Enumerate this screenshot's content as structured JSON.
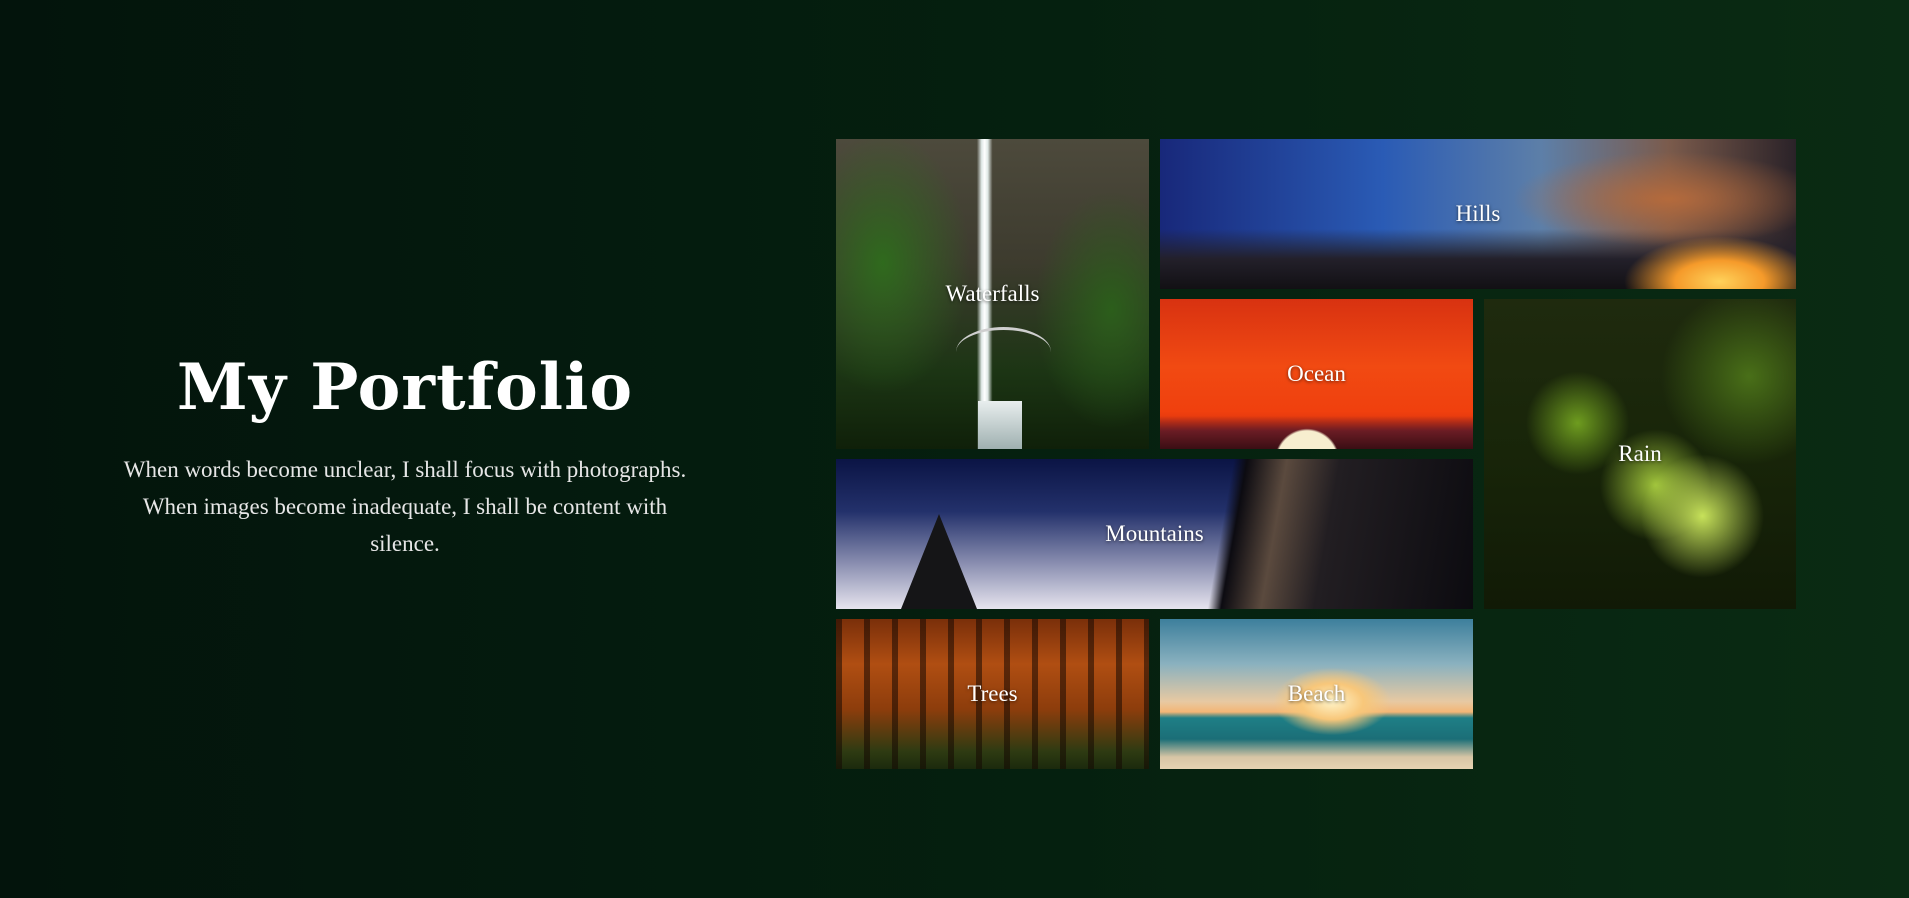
{
  "intro": {
    "title": "My Portfolio",
    "description": "When words become unclear, I shall focus with photographs. When images become inadequate, I shall be content with silence."
  },
  "gallery": {
    "tiles": [
      {
        "label": "Waterfalls"
      },
      {
        "label": "Hills"
      },
      {
        "label": "Ocean"
      },
      {
        "label": "Rain"
      },
      {
        "label": "Mountains"
      },
      {
        "label": "Trees"
      },
      {
        "label": "Beach"
      }
    ]
  },
  "colors": {
    "background_dark": "#03140c",
    "background_light": "#0a2b13",
    "text": "#ffffff"
  }
}
